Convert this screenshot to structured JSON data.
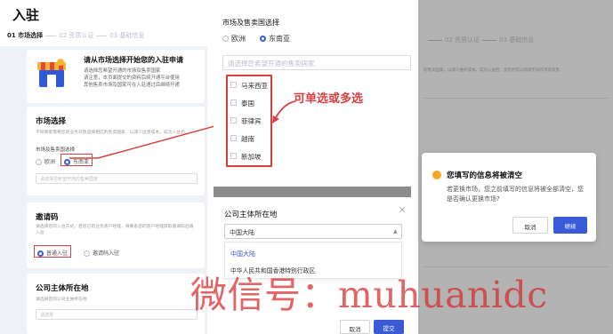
{
  "panel1": {
    "title": "入驻",
    "steps": [
      "01 市场选择",
      "02 资质认证",
      "03 基础信息"
    ],
    "intro": {
      "title": "请从市场选择开始您的入驻申请",
      "lines": [
        "请选择您希望开通的市场及售卖国家",
        "请注意，本页面提交的资料后续开通平台使用",
        "其他售卖市场及国家可在入驻通过后继续开通"
      ]
    },
    "market": {
      "title": "市场选择",
      "desc": "不同商家需要您的业务开放选择相应的售卖国家，以减少运营成本，成功入驻后。",
      "label": "市场及售卖国选择",
      "options": [
        "欧洲",
        "东南亚"
      ],
      "selected": "东南亚",
      "country_placeholder": "请选择您希望开通的售卖国家"
    },
    "invite": {
      "title": "邀请码",
      "desc": "请选择您的入驻方式。若您已有业务客户经理，请联系您的客户经理获取邀请码后再入驻",
      "options": [
        "普通入驻",
        "邀请码入驻"
      ],
      "selected": "普通入驻"
    },
    "company": {
      "title": "公司主体所在地",
      "desc": "请选择您的公司主体所在地",
      "placeholder": "请选择"
    }
  },
  "panel2": {
    "title": "市场及售卖国选择",
    "options": [
      "欧洲",
      "东南亚"
    ],
    "selected": "东南亚",
    "placeholder": "请选择您希望开通的售卖国家",
    "countries": [
      "马来西亚",
      "泰国",
      "菲律宾",
      "越南",
      "新加坡"
    ],
    "annotation": "可单选或多选",
    "modal": {
      "title": "公司主体所在地",
      "close": "×",
      "value": "中国大陆",
      "options": [
        "中国大陆",
        "中华人民共和国香港特别行政区"
      ],
      "cancel": "取消",
      "confirm": "提交"
    }
  },
  "panel3": {
    "steps": [
      "02 资质认证",
      "03 基础信息"
    ],
    "bg_text": "的售卖国家，以减少维护成本，成功入驻后，您仍然可以新增不同的市场及售",
    "dialog": {
      "title": "您填写的信息将被清空",
      "body": "若更换市场，您之前填写的信息将被全部清空，您是否确认更换市场?",
      "cancel": "取消",
      "ok": "继续"
    }
  },
  "watermark": "微信号：muhuanidc",
  "colors": {
    "accent": "#3a5ad8",
    "annotation_red": "#d84040",
    "warning": "#f5a623"
  }
}
